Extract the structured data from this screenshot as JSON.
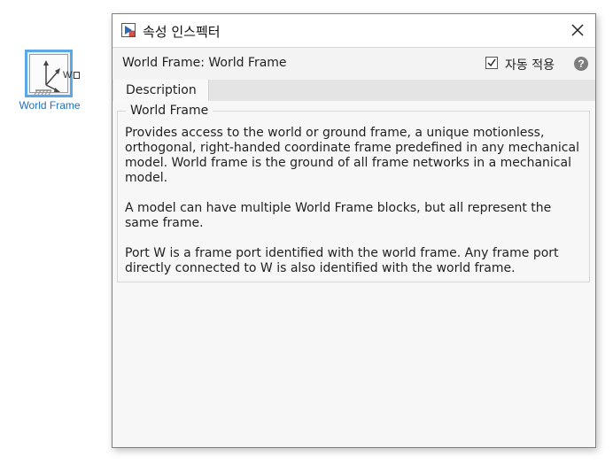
{
  "canvas": {
    "block_name": "World Frame",
    "port_label": "W"
  },
  "dialog": {
    "title": "속성 인스펙터",
    "header_title": "World Frame: World Frame",
    "auto_apply_label": "자동 적용",
    "auto_apply_checked": true,
    "help_glyph": "?",
    "tabs": [
      {
        "label": "Description",
        "active": true
      }
    ],
    "group_title": "World Frame",
    "paragraphs": [
      "Provides access to the world or ground frame, a unique motionless, orthogonal, right-handed coordinate frame predefined in any mechanical model. World frame is the ground of all frame networks in a mechanical model.",
      "A model can have multiple World Frame blocks, but all represent the same frame.",
      "Port W is a frame port identified with the world frame. Any frame port directly connected to W is also identified with the world frame."
    ]
  },
  "colors": {
    "block_selection": "#5aa9e6",
    "block_label": "#1f6fc0"
  },
  "icons": {
    "title_icon": "property-inspector-icon",
    "close_icon": "close-icon",
    "checkbox": "checkmark-icon",
    "help": "help-icon",
    "block": "world-frame-icon"
  }
}
